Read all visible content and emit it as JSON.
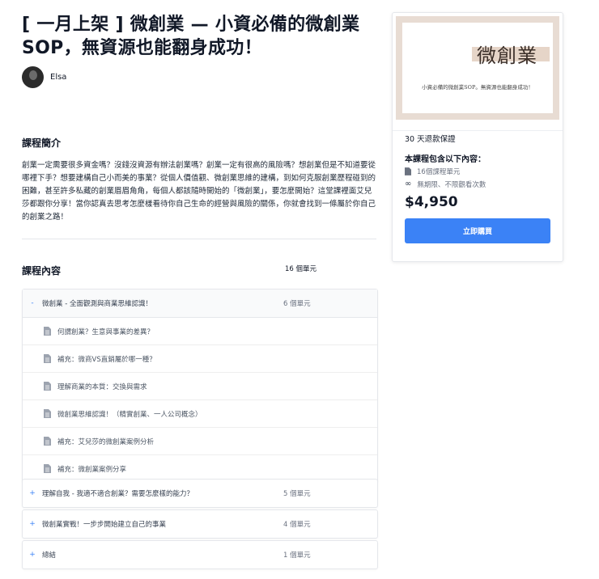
{
  "course": {
    "title": "[ 一月上架 ] 微創業 — 小資必備的微創業SOP，無資源也能翻身成功！",
    "author": "Elsa"
  },
  "intro": {
    "heading": "課程簡介",
    "body": "創業一定需要很多資金嗎？沒錢沒資源有辦法創業嗎？創業一定有很高的風險嗎？想創業但是不知道要從哪裡下手？想要建構自己小而美的事業？從個人價值觀、微創業思維的建構，到如何克服創業歷程碰到的困難，甚至許多私藏的創業眉眉角角，每個人都該隨時開始的「微創業」，要怎麼開始？這堂課裡面艾兒莎都跟你分享！當你認真去思考怎麼樣看待你自己生命的經營與風險的關係，你就會找到一條屬於你自己的創業之路！"
  },
  "curriculum": {
    "heading": "課程內容",
    "total_units": "16 個單元",
    "modules": [
      {
        "sign": "-",
        "title": "微創業 - 全面觀測與商業思維認識！",
        "count": "6 個單元",
        "lessons": [
          "何謂創業？生意與事業的差異？",
          "補充：微商VS直銷屬於哪一種？",
          "理解商業的本質：交換與需求",
          "微創業思維認識！（精實創業、一人公司概念）",
          "補充：艾兒莎的微創業案例分析",
          "補充：微創業案例分享"
        ]
      },
      {
        "sign": "+",
        "title": "理解自我 - 我適不適合創業？需要怎麼樣的能力？",
        "count": "5 個單元"
      },
      {
        "sign": "+",
        "title": "微創業實戰！一步步開始建立自己的事業",
        "count": "4 個單元"
      },
      {
        "sign": "+",
        "title": "總結",
        "count": "1 個單元"
      }
    ]
  },
  "sidebar": {
    "cover_title": "微創業",
    "cover_subtitle": "小資必備的微創業SOP。無資源也能翻身成功！",
    "refund": "30 天退款保證",
    "includes_heading": "本課程包含以下內容：",
    "features": [
      {
        "icon": "document-icon",
        "text": "16個課程單元"
      },
      {
        "icon": "infinity-icon",
        "text": "無期限、不限觀看次數"
      }
    ],
    "price": "$4,950",
    "buy_label": "立即購買"
  },
  "colors": {
    "accent": "#3b82f6",
    "cover_background": "#e8dcd3",
    "text_primary": "#111827",
    "text_muted": "#6b7280"
  }
}
